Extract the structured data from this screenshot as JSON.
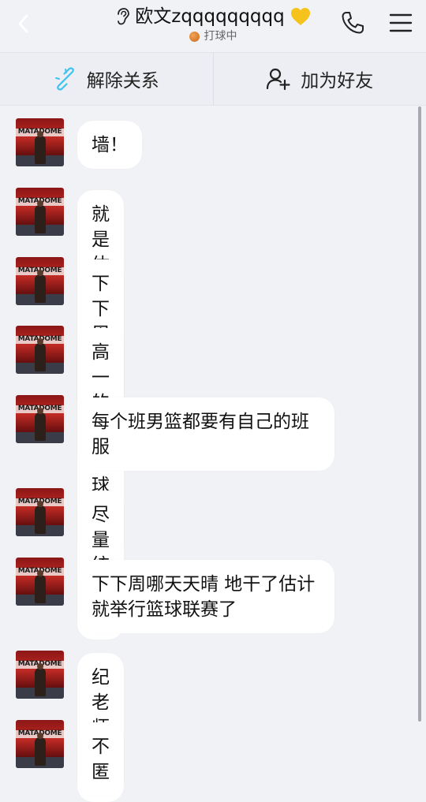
{
  "header": {
    "title": "欧文zqqqqqqqqq",
    "status": "打球中",
    "icons": {
      "back": "chevron-left-icon",
      "ear": "ear-icon",
      "heart": "yellow-heart-icon",
      "phone": "phone-icon",
      "menu": "hamburger-menu-icon",
      "status": "basketball-icon"
    }
  },
  "actions": {
    "unbind_label": "解除关系",
    "add_friend_label": "加为好友",
    "unbind_icon": "broken-link-icon",
    "add_friend_icon": "add-user-icon"
  },
  "avatar": {
    "text": "MATADOME"
  },
  "messages": [
    {
      "text": "墙！"
    },
    {
      "text": "就是体育纪老师说"
    },
    {
      "text": "下下周可能举行篮球联赛"
    },
    {
      "text": "高一的"
    },
    {
      "text": "每个班男篮都要有自己的班服"
    },
    {
      "text": "尽量统一下"
    },
    {
      "text": "下下周哪天天晴 地干了估计就举行篮球联赛了"
    },
    {
      "text": "纪老师原话"
    },
    {
      "text": "不匿"
    }
  ],
  "colors": {
    "background": "#f1f2f6",
    "bubble": "#ffffff",
    "action_icon_accent": "#3ec3f0",
    "heart": "#f5c518"
  }
}
